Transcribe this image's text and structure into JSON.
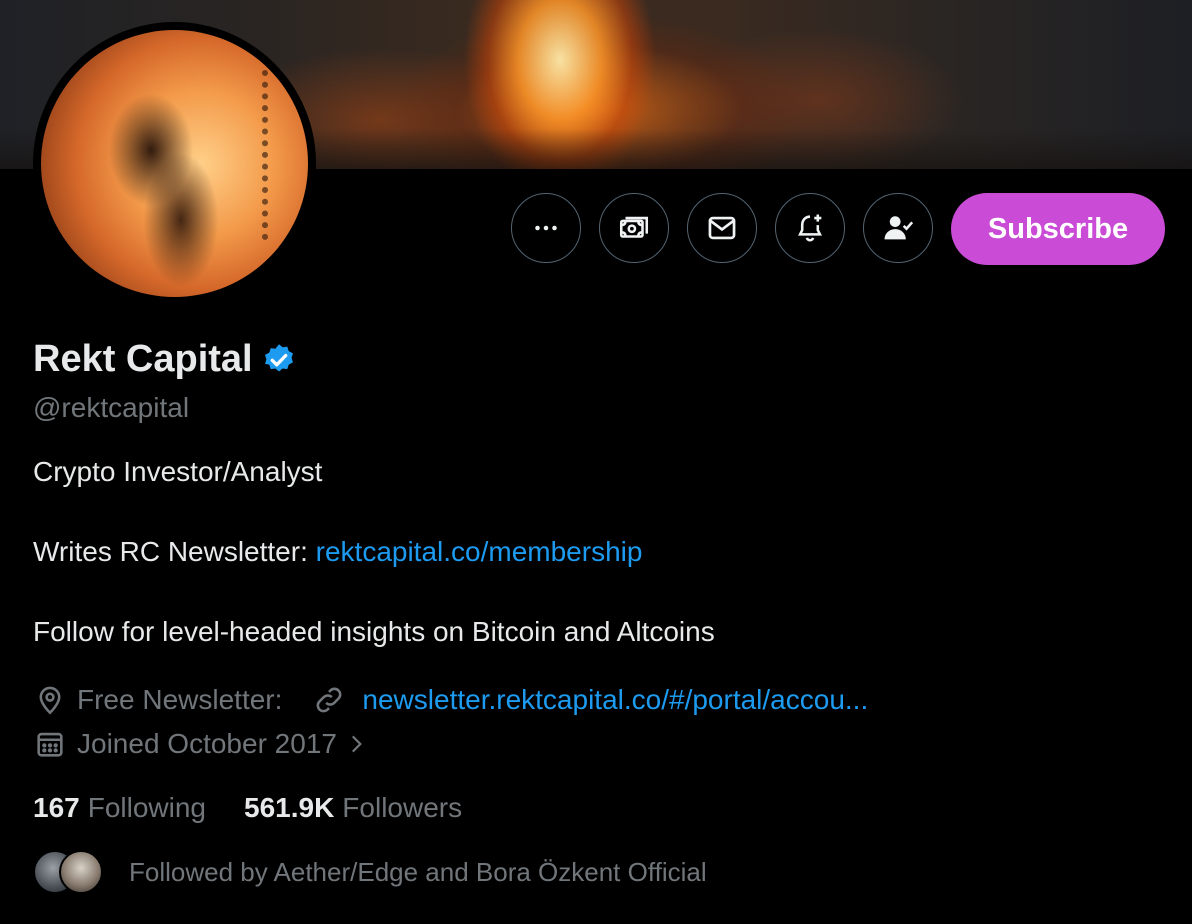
{
  "profile": {
    "name": "Rekt Capital",
    "handle": "@rektcapital",
    "bio_line1": "Crypto Investor/Analyst",
    "bio_line2_prefix": "Writes RC Newsletter: ",
    "bio_line2_link": "rektcapital.co/membership",
    "bio_line3": "Follow for level-headed insights on Bitcoin and Altcoins",
    "location": "Free Newsletter:",
    "website": "newsletter.rektcapital.co/#/portal/accou...",
    "joined": "Joined October 2017",
    "following_count": "167",
    "following_label": "Following",
    "followers_count": "561.9K",
    "followers_label": "Followers",
    "followed_by": "Followed by Aether/Edge and Bora Özkent Official"
  },
  "actions": {
    "more": "more-icon",
    "tip": "money-icon",
    "message": "mail-icon",
    "notify": "bell-plus-icon",
    "following": "person-check-icon",
    "subscribe_label": "Subscribe"
  },
  "colors": {
    "background": "#000000",
    "text": "#e7e9ea",
    "muted": "#71767b",
    "link": "#1d9bf0",
    "subscribe": "#c94bd6",
    "verified": "#1d9bf0"
  }
}
